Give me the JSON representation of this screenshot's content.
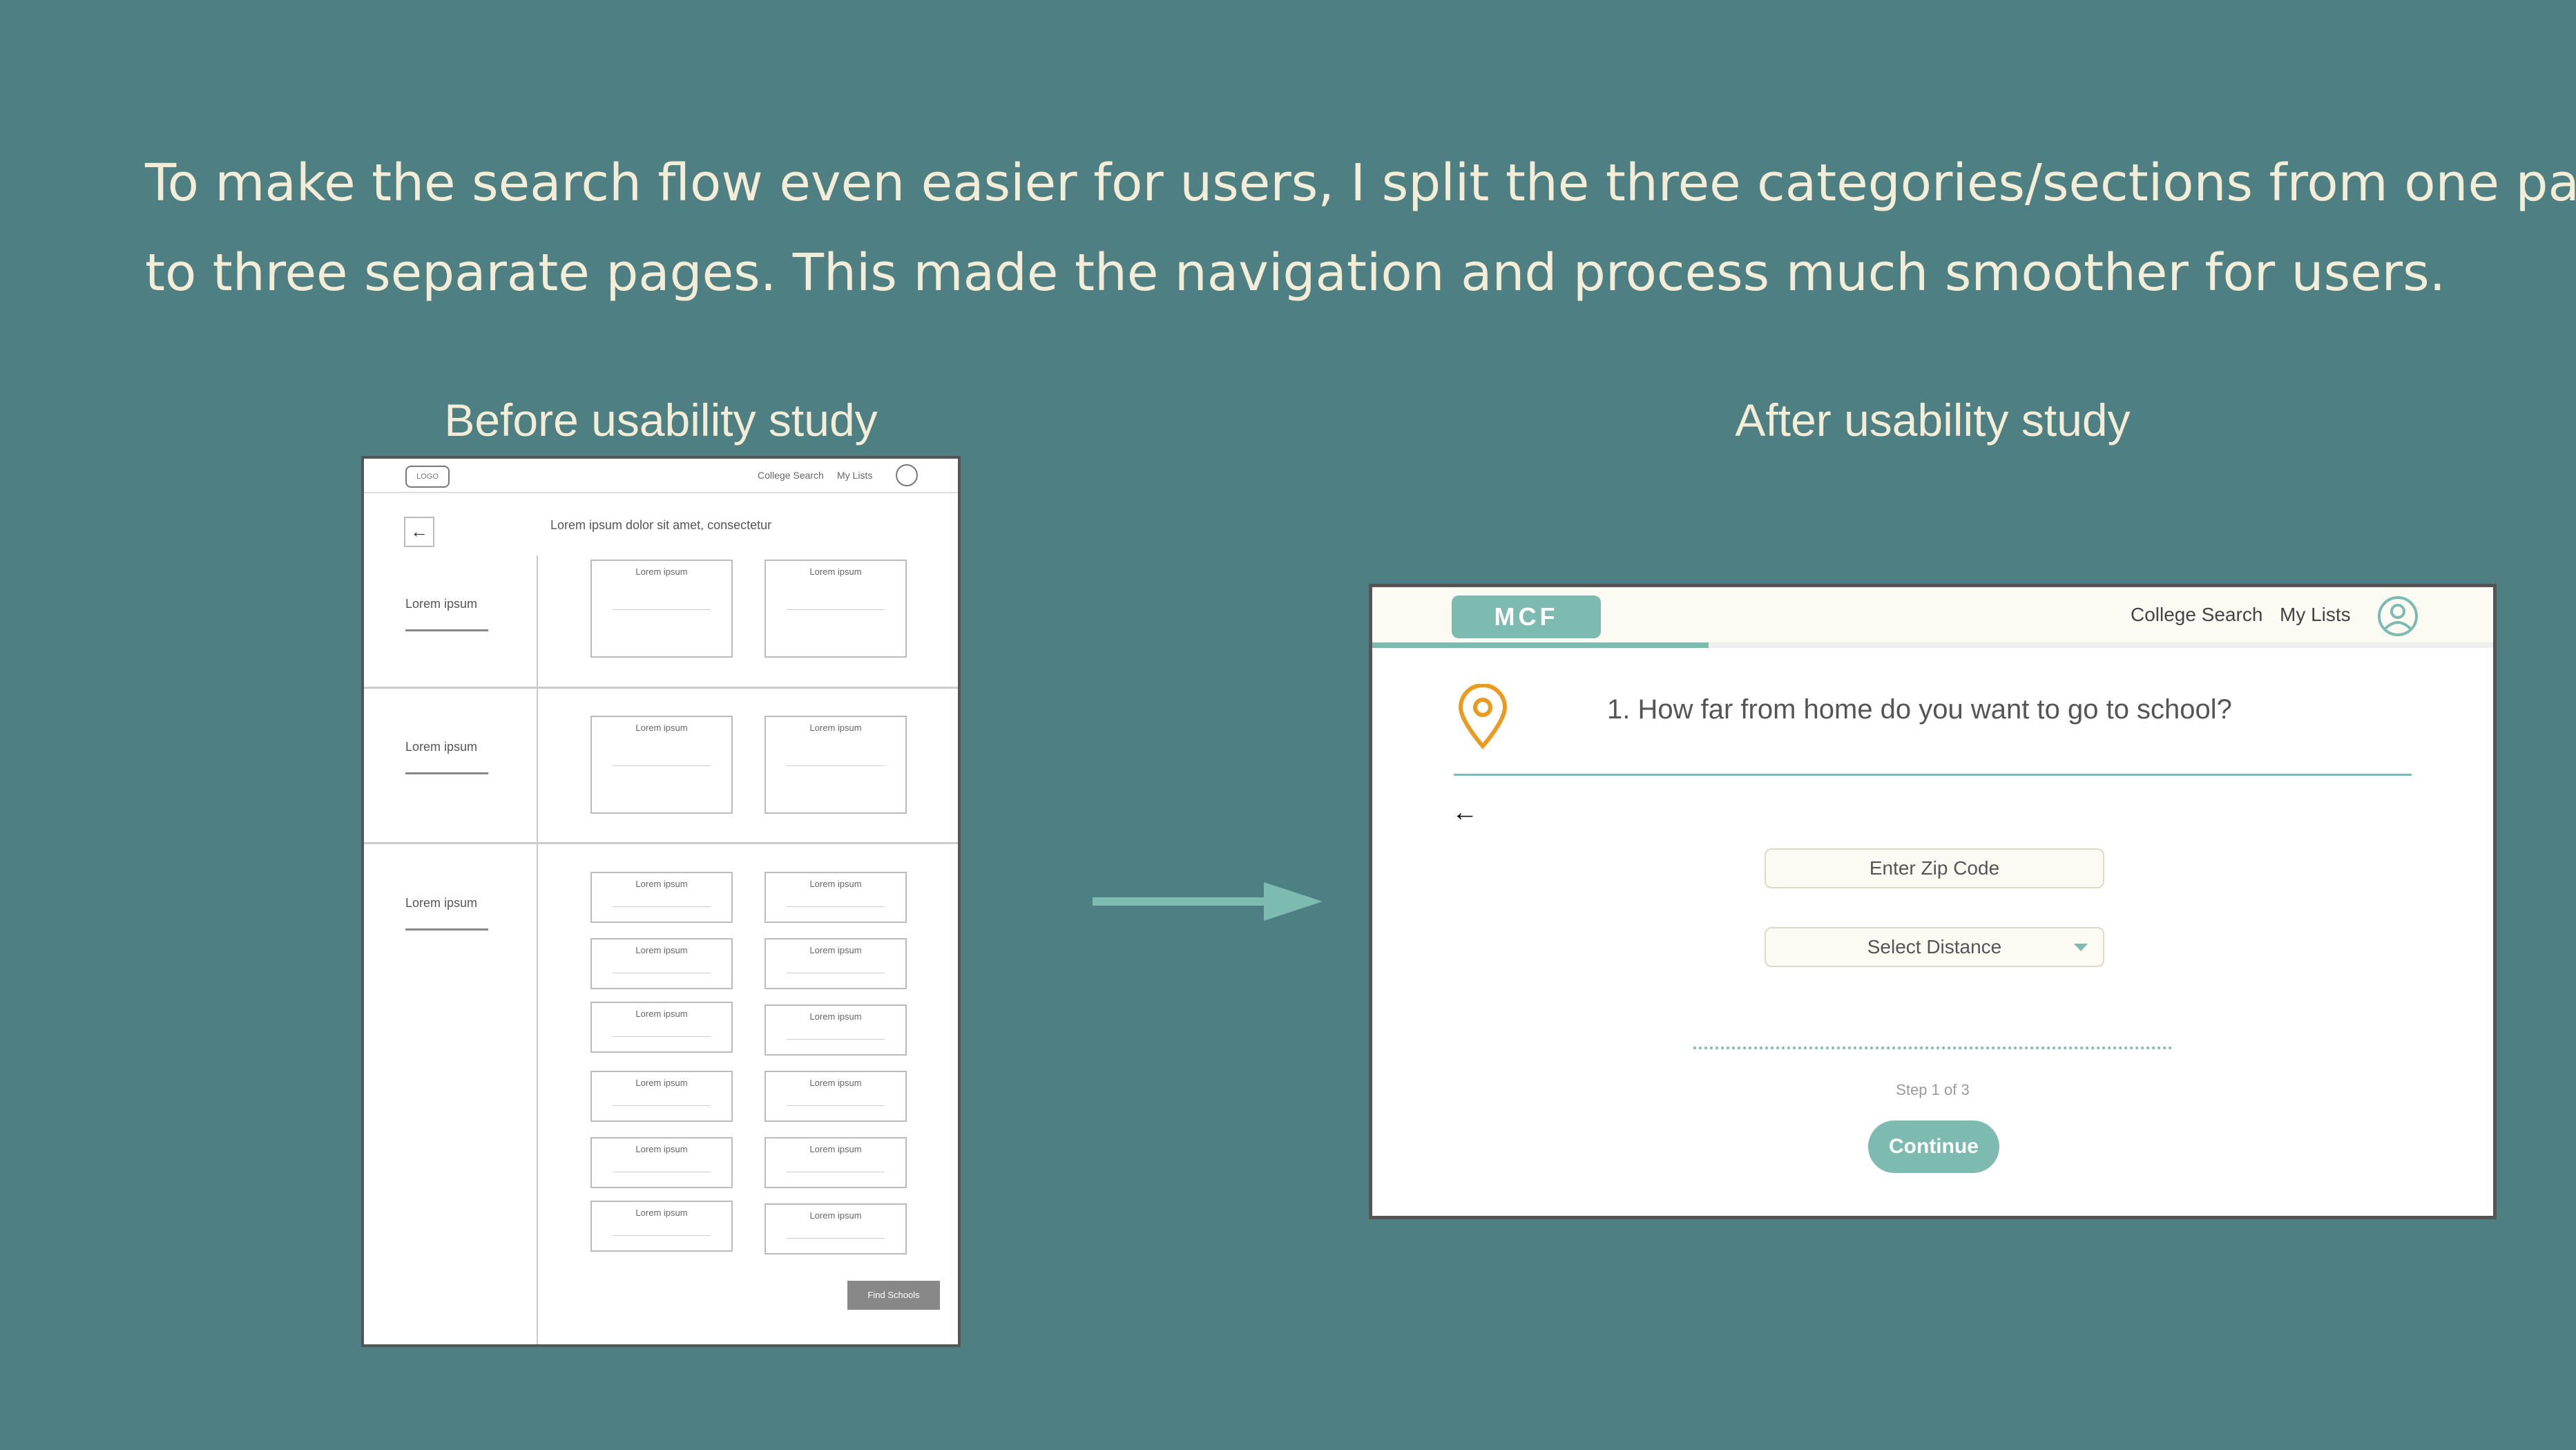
{
  "intro": {
    "line1": "To make the search flow even easier for users, I split the three categories/sections from one page",
    "line2": "to three separate pages. This made the navigation and process much smoother for users."
  },
  "before": {
    "title": "Before usability study",
    "logo": "LOGO",
    "nav_search": "College Search",
    "nav_lists": "My Lists",
    "back_icon": "←",
    "heading": "Lorem ipsum dolor sit amet, consectetur",
    "sections": [
      "Lorem ipsum",
      "Lorem ipsum",
      "Lorem ipsum"
    ],
    "card_label": "Lorem ipsum",
    "button": "Find Schools"
  },
  "after": {
    "title": "After usability study",
    "brand": "MCF",
    "nav_search": "College Search",
    "nav_lists": "My Lists",
    "progress": 0.3,
    "question": "1. How far from home do you want to go to school?",
    "back_icon": "←",
    "zip_placeholder": "Enter Zip Code",
    "distance_select": "Select Distance",
    "step": "Step 1 of 3",
    "continue": "Continue"
  },
  "colors": {
    "background": "#4E7F82",
    "accent": "#7DBAB0",
    "pin": "#E99A1F",
    "text_light": "#F3ECD6"
  }
}
